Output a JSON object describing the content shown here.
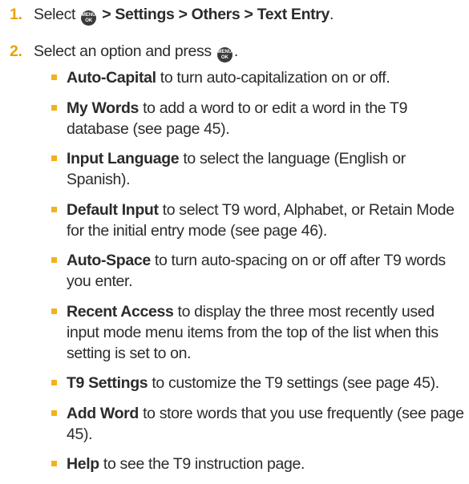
{
  "steps": [
    {
      "num": "1.",
      "text_before": "Select",
      "path": "> Settings > Others > Text Entry",
      "text_after": "."
    },
    {
      "num": "2.",
      "text_before": "Select an option and press",
      "text_after": "."
    }
  ],
  "menu_key": {
    "top": "MENU",
    "bottom": "OK",
    "icon": "menu-ok-key-icon"
  },
  "options": [
    {
      "term": "Auto-Capital",
      "desc": " to turn auto-capitalization on or off."
    },
    {
      "term": "My Words",
      "desc": " to add a word to or edit a word in the T9 database (see page 45)."
    },
    {
      "term": "Input Language",
      "desc": " to select the language (English or Spanish)."
    },
    {
      "term": "Default Input",
      "desc": " to select T9 word, Alphabet, or Retain Mode for the initial entry mode (see page 46)."
    },
    {
      "term": "Auto-Space",
      "desc": " to turn auto-spacing on or off after T9 words you enter."
    },
    {
      "term": "Recent Access",
      "desc": " to display the three most recently used input mode menu items from the top of the list when this setting is set to on."
    },
    {
      "term": "T9 Settings",
      "desc": " to customize the T9 settings (see page 45)."
    },
    {
      "term": "Add Word",
      "desc": " to store words that you use frequently (see page 45)."
    },
    {
      "term": "Help",
      "desc": " to see the T9 instruction page."
    }
  ],
  "colors": {
    "step_number": "#e8a300",
    "bullet": "#f2b21c",
    "text": "#2b2b2b"
  }
}
